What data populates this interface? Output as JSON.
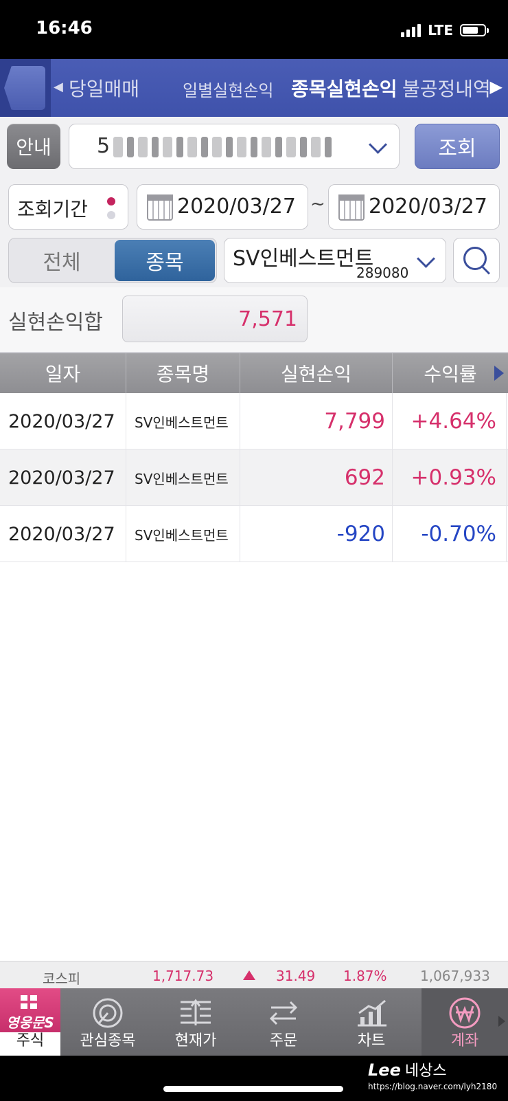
{
  "status_bar": {
    "time": "16:46",
    "network": "LTE"
  },
  "top_tabs": [
    {
      "label": "당일매매"
    },
    {
      "label": "일별실현손익"
    },
    {
      "label": "종목실현손익"
    },
    {
      "label": "불공정내역"
    }
  ],
  "account": {
    "guide_label": "안내",
    "number_visible": "5",
    "query_label": "조회"
  },
  "period": {
    "label": "조회기간",
    "start_date": "2020/03/27",
    "separator": "~",
    "end_date": "2020/03/27"
  },
  "filter": {
    "all_label": "전체",
    "stock_label": "종목",
    "stock_name": "SV인베스트먼트",
    "stock_code": "289080"
  },
  "summary": {
    "label": "실현손익합",
    "value": "7,571"
  },
  "table": {
    "headers": {
      "date": "일자",
      "name": "종목명",
      "pl": "실현손익",
      "rate": "수익률"
    },
    "rows": [
      {
        "date": "2020/03/27",
        "name": "SV인베스트먼트",
        "pl": "7,799",
        "rate": "+4.64%",
        "sign": "pos"
      },
      {
        "date": "2020/03/27",
        "name": "SV인베스트먼트",
        "pl": "692",
        "rate": "+0.93%",
        "sign": "pos"
      },
      {
        "date": "2020/03/27",
        "name": "SV인베스트먼트",
        "pl": "-920",
        "rate": "-0.70%",
        "sign": "neg"
      }
    ]
  },
  "ticker": {
    "index_name": "코스피",
    "index_value": "1,717.73",
    "change": "31.49",
    "change_pct": "1.87%",
    "volume": "1,067,933"
  },
  "bottom_nav": {
    "home_brand": "영웅문S",
    "home_label": "주식",
    "items": [
      {
        "label": "관심종목"
      },
      {
        "label": "현재가"
      },
      {
        "label": "주문"
      },
      {
        "label": "차트"
      },
      {
        "label": "계좌"
      }
    ]
  },
  "watermark": {
    "brand": "Lee",
    "suffix": "네상스",
    "url": "https://blog.naver.com/lyh2180"
  },
  "colors": {
    "positive": "#d6306b",
    "negative": "#2546c4",
    "header_blue": "#3f52ab"
  }
}
